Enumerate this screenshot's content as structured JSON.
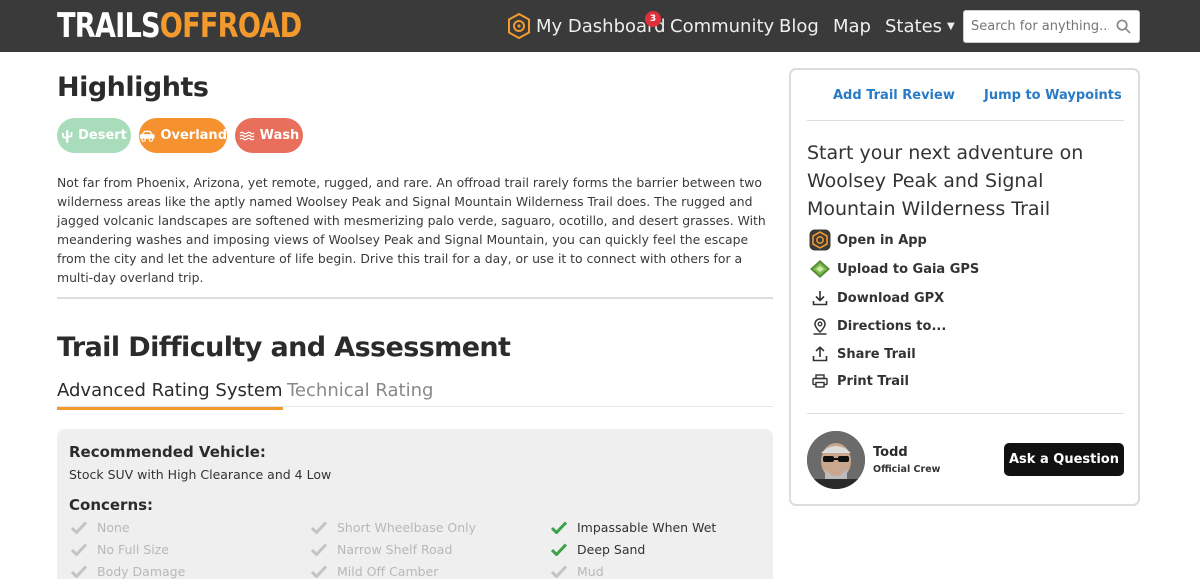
{
  "header": {
    "logo_left": "TRAILS",
    "logo_right": "OFFROAD",
    "nav": {
      "dashboard": "My Dashboard",
      "dashboard_badge": "3",
      "community": "Community",
      "blog": "Blog",
      "map": "Map",
      "states": "States"
    },
    "search": {
      "placeholder": "Search for anything..."
    }
  },
  "highlights": {
    "title": "Highlights",
    "tags": [
      {
        "label": "Desert",
        "icon": "cactus-icon",
        "color": "#a8dcbb"
      },
      {
        "label": "Overland",
        "icon": "vehicle-icon",
        "color": "#f5922f"
      },
      {
        "label": "Wash",
        "icon": "wash-icon",
        "color": "#e76f5c"
      }
    ],
    "description": "Not far from Phoenix, Arizona, yet remote, rugged, and rare. An offroad trail rarely forms the barrier between two wilderness areas like the aptly named Woolsey Peak and Signal Mountain Wilderness Trail does. The rugged and jagged volcanic landscapes are softened with mesmerizing palo verde, saguaro, ocotillo, and desert grasses. With meandering washes and imposing views of Woolsey Peak and Signal Mountain, you can quickly feel the escape from the city and let the adventure of life begin. Drive this trail for a day, or use it to connect with others for a multi-day overland trip."
  },
  "difficulty": {
    "title": "Trail Difficulty and Assessment",
    "tabs": [
      {
        "label": "Advanced Rating System",
        "active": true
      },
      {
        "label": "Technical Rating",
        "active": false
      }
    ],
    "recommended_vehicle_label": "Recommended Vehicle:",
    "recommended_vehicle": "Stock SUV with High Clearance and 4 Low",
    "concerns_label": "Concerns:",
    "concerns": [
      {
        "label": "None",
        "active": false
      },
      {
        "label": "Short Wheelbase Only",
        "active": false
      },
      {
        "label": "Impassable When Wet",
        "active": true
      },
      {
        "label": "No Full Size",
        "active": false
      },
      {
        "label": "Narrow Shelf Road",
        "active": false
      },
      {
        "label": "Deep Sand",
        "active": true
      },
      {
        "label": "Body Damage",
        "active": false
      },
      {
        "label": "Mild Off Camber",
        "active": false
      },
      {
        "label": "Mud",
        "active": false
      }
    ]
  },
  "sidebar": {
    "add_review": "Add Trail Review",
    "jump_waypoints": "Jump to Waypoints",
    "cta": "Start your next adventure on Woolsey Peak and Signal Mountain Wilderness Trail",
    "actions": [
      {
        "label": "Open in App",
        "icon": "app-icon"
      },
      {
        "label": "Upload to Gaia GPS",
        "icon": "gaia-gps-icon"
      },
      {
        "label": "Download GPX",
        "icon": "download-icon"
      },
      {
        "label": "Directions to...",
        "icon": "map-pin-icon"
      },
      {
        "label": "Share Trail",
        "icon": "share-icon"
      },
      {
        "label": "Print Trail",
        "icon": "print-icon"
      }
    ],
    "crew": {
      "name": "Todd",
      "role": "Official Crew"
    },
    "ask_button": "Ask a Question"
  },
  "colors": {
    "accent": "#f39a2e",
    "link": "#2a7bc6",
    "check_active": "#3aa24a",
    "check_inactive": "#c4c4c4"
  }
}
